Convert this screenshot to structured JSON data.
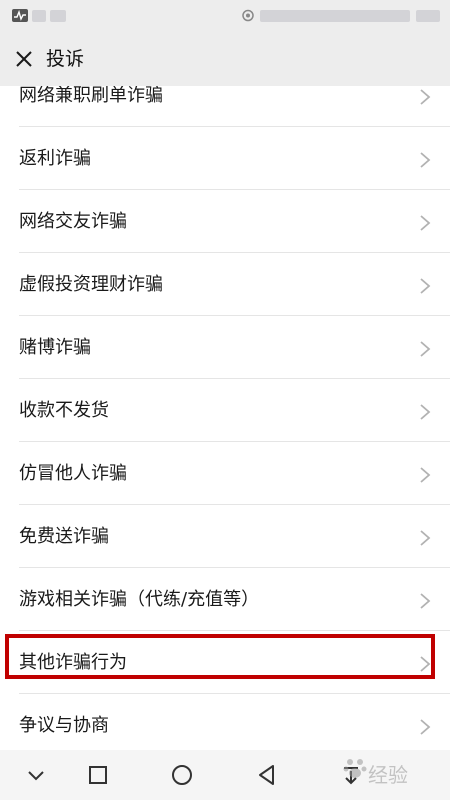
{
  "nav": {
    "title": "投诉"
  },
  "items": [
    {
      "label": "网络兼职刷单诈骗"
    },
    {
      "label": "返利诈骗"
    },
    {
      "label": "网络交友诈骗"
    },
    {
      "label": "虚假投资理财诈骗"
    },
    {
      "label": "赌博诈骗"
    },
    {
      "label": "收款不发货"
    },
    {
      "label": "仿冒他人诈骗"
    },
    {
      "label": "免费送诈骗"
    },
    {
      "label": "游戏相关诈骗（代练/充值等）"
    },
    {
      "label": "其他诈骗行为",
      "highlighted": true
    },
    {
      "label": "争议与协商"
    }
  ],
  "watermark": {
    "text": "经验"
  },
  "colors": {
    "highlight": "#c00000",
    "background": "#ededed",
    "list_bg": "#ffffff"
  },
  "icons": [
    "close-icon",
    "chevron-right-icon",
    "chevron-down-icon",
    "square-icon",
    "circle-icon",
    "triangle-back-icon",
    "download-icon"
  ]
}
